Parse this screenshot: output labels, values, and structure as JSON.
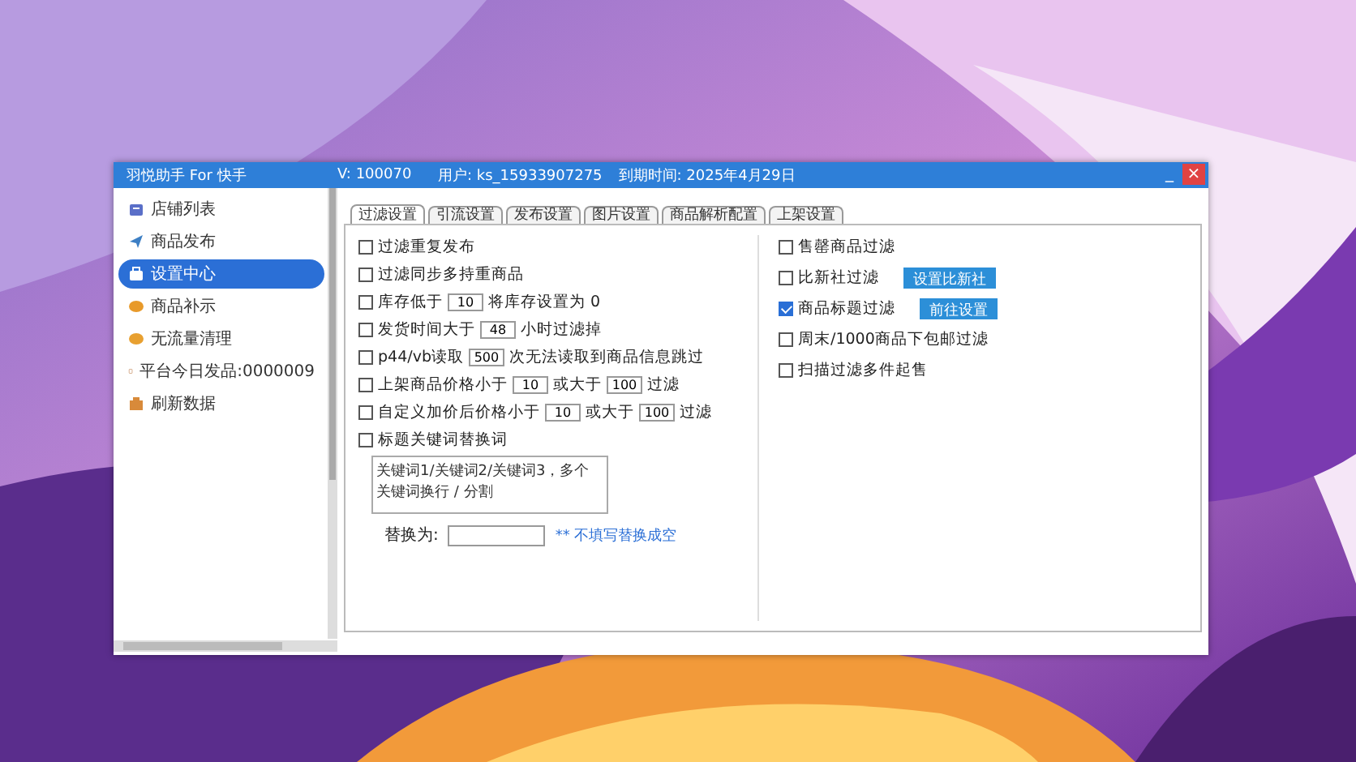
{
  "window": {
    "title": "羽悦助手 For 快手",
    "version": "V: 100070",
    "user": "用户: ks_15933907275",
    "expiry": "到期时间: 2025年4月29日",
    "controls": [
      "_",
      "×"
    ]
  },
  "sidebar": {
    "items": [
      {
        "label": "店铺列表",
        "selected": false
      },
      {
        "label": "商品发布",
        "selected": false
      },
      {
        "label": "设置中心",
        "selected": true
      },
      {
        "label": "商品补示",
        "selected": false
      },
      {
        "label": "无流量清理",
        "selected": false
      },
      {
        "label": "平台今日发品:0000009",
        "selected": false
      },
      {
        "label": "刷新数据",
        "selected": false
      }
    ]
  },
  "tabs": [
    {
      "label": "过滤设置",
      "selected": true
    },
    {
      "label": "引流设置",
      "selected": false
    },
    {
      "label": "发布设置",
      "selected": false
    },
    {
      "label": "图片设置",
      "selected": false
    },
    {
      "label": "商品解析配置",
      "selected": false
    },
    {
      "label": "上架设置",
      "selected": false
    }
  ],
  "left_options": [
    {
      "checked": false,
      "parts": [
        {
          "text": "过滤重复发布"
        }
      ]
    },
    {
      "checked": false,
      "parts": [
        {
          "text": "过滤同步多持重商品"
        }
      ]
    },
    {
      "checked": false,
      "parts": [
        {
          "text": "库存低于"
        },
        {
          "value": "10"
        },
        {
          "text": "将库存设置为 0"
        }
      ]
    },
    {
      "checked": false,
      "parts": [
        {
          "text": "发货时间大于"
        },
        {
          "value": "48"
        },
        {
          "text": "小时过滤掉"
        }
      ]
    },
    {
      "checked": false,
      "parts": [
        {
          "text": "p44/vb读取"
        },
        {
          "value": "500"
        },
        {
          "text": "次无法读取到商品信息跳过"
        }
      ]
    },
    {
      "checked": false,
      "parts": [
        {
          "text": "上架商品价格小于"
        },
        {
          "value": "10"
        },
        {
          "text": "或大于"
        },
        {
          "value": "100"
        },
        {
          "text": "过滤"
        }
      ]
    },
    {
      "checked": false,
      "parts": [
        {
          "text": "自定义加价后价格小于"
        },
        {
          "value": "10"
        },
        {
          "text": "或大于"
        },
        {
          "value": "100"
        },
        {
          "text": "过滤"
        }
      ]
    },
    {
      "checked": false,
      "parts": [
        {
          "text": "标题关键词替换词"
        }
      ]
    }
  ],
  "keywords": {
    "value": "关键词1/关键词2/关键词3，多个关键词换行 / 分割"
  },
  "replace": {
    "label": "替换为:",
    "hint": "** 不填写替换成空"
  },
  "right_options": [
    {
      "checked": false,
      "label": "售罄商品过滤"
    },
    {
      "checked": false,
      "label": "比新社过滤",
      "button": "设置比新社"
    },
    {
      "checked": true,
      "label": "商品标题过滤",
      "button": "前往设置"
    },
    {
      "checked": false,
      "label": "周末/1000商品下包邮过滤"
    },
    {
      "checked": false,
      "label": "扫描过滤多件起售"
    }
  ]
}
